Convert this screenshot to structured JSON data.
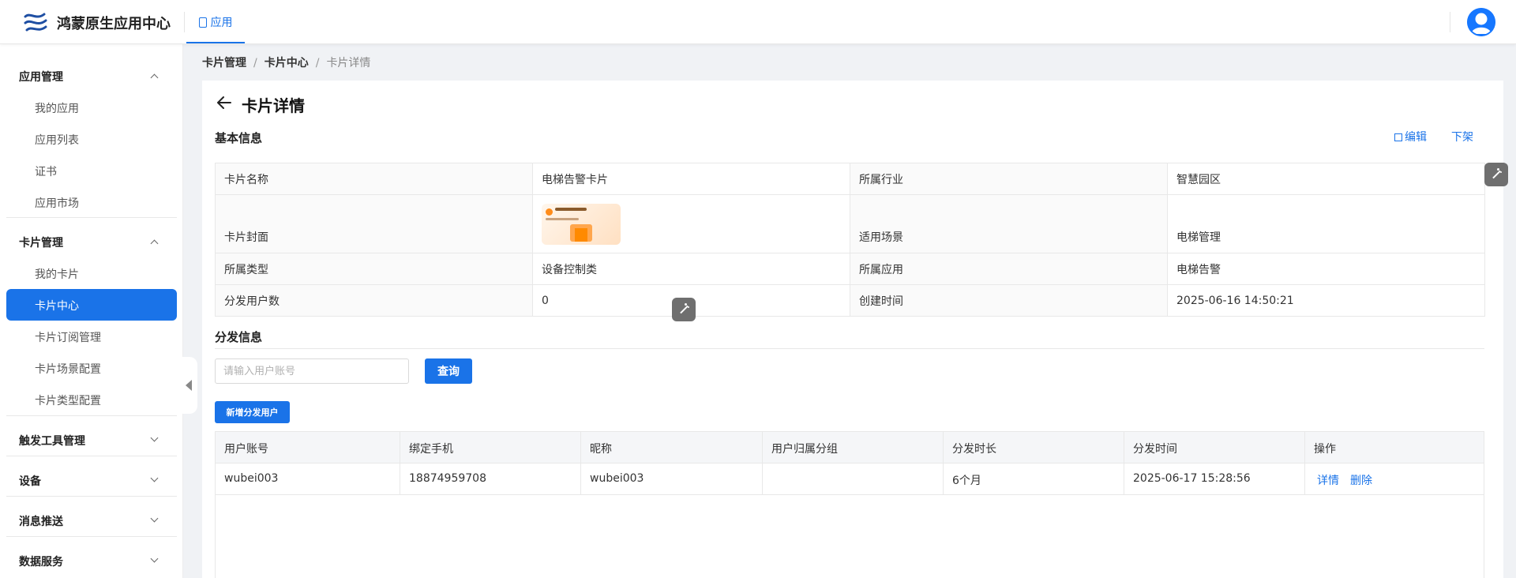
{
  "header": {
    "app_name": "鸿蒙原生应用中心",
    "active_tab": "应用"
  },
  "sidebar": {
    "groups": [
      {
        "label": "应用管理",
        "expanded": true,
        "items": [
          "我的应用",
          "应用列表",
          "证书",
          "应用市场"
        ]
      },
      {
        "label": "卡片管理",
        "expanded": true,
        "items": [
          "我的卡片",
          "卡片中心",
          "卡片订阅管理",
          "卡片场景配置",
          "卡片类型配置"
        ]
      },
      {
        "label": "触发工具管理",
        "expanded": false,
        "items": []
      },
      {
        "label": "设备",
        "expanded": false,
        "items": []
      },
      {
        "label": "消息推送",
        "expanded": false,
        "items": []
      },
      {
        "label": "数据服务",
        "expanded": false,
        "items": []
      }
    ],
    "active_item": "卡片中心"
  },
  "breadcrumb": [
    "卡片管理",
    "卡片中心",
    "卡片详情"
  ],
  "page": {
    "title": "卡片详情",
    "basic_section": "基本信息",
    "edit_label": "编辑",
    "offline_label": "下架",
    "distribution_section": "分发信息"
  },
  "basic_info": {
    "card_name_label": "卡片名称",
    "card_name": "电梯告警卡片",
    "industry_label": "所属行业",
    "industry": "智慧园区",
    "cover_label": "卡片封面",
    "scene_label": "适用场景",
    "scene": "电梯管理",
    "type_label": "所属类型",
    "type": "设备控制类",
    "app_label": "所属应用",
    "app": "电梯告警",
    "users_label": "分发用户数",
    "users": "0",
    "created_label": "创建时间",
    "created": "2025-06-16 14:50:21"
  },
  "search": {
    "placeholder": "请输入用户账号",
    "query_label": "查询",
    "add_label": "新增分发用户"
  },
  "dist_table": {
    "columns": [
      "用户账号",
      "绑定手机",
      "昵称",
      "用户归属分组",
      "分发时长",
      "分发时间",
      "操作"
    ],
    "rows": [
      {
        "account": "wubei003",
        "phone": "18874959708",
        "nickname": "wubei003",
        "group": "",
        "duration": "6个月",
        "time": "2025-06-17 15:28:56",
        "ops": [
          "详情",
          "删除"
        ]
      }
    ]
  },
  "colors": {
    "accent": "#1a73e8",
    "active_menu": "#1a73e8"
  }
}
